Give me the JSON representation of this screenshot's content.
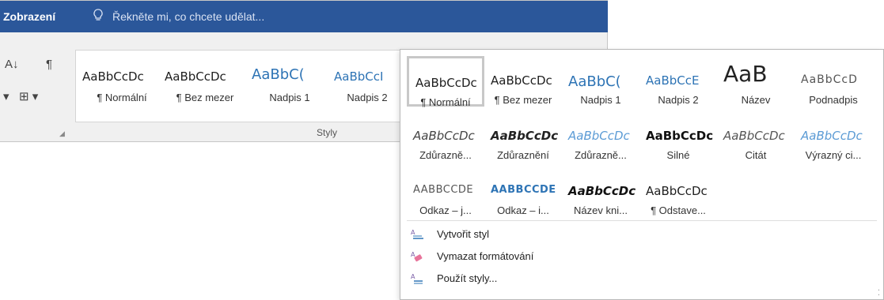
{
  "titlebar": {
    "tab_view": "Zobrazení",
    "tellme_placeholder": "Řekněte mi, co chcete udělat..."
  },
  "ribbon": {
    "gallery": [
      {
        "sample": "AaBbCcDc",
        "label": "¶ Normální",
        "style": "s-normal"
      },
      {
        "sample": "AaBbCcDc",
        "label": "¶ Bez mezer",
        "style": "s-normal"
      },
      {
        "sample": "AaBbC(",
        "label": "Nadpis 1",
        "style": "s-heading"
      },
      {
        "sample": "AaBbCcI",
        "label": "Nadpis 2",
        "style": "s-heading2"
      }
    ],
    "group_caption": "Styly"
  },
  "dropdown": {
    "styles": [
      {
        "sample": "AaBbCcDc",
        "label": "¶ Normální",
        "style": "s-normal",
        "selected": true
      },
      {
        "sample": "AaBbCcDc",
        "label": "¶ Bez mezer",
        "style": "s-normal"
      },
      {
        "sample": "AaBbC(",
        "label": "Nadpis 1",
        "style": "s-heading"
      },
      {
        "sample": "AaBbCcE",
        "label": "Nadpis 2",
        "style": "s-heading2"
      },
      {
        "sample": "AaB",
        "label": "Název",
        "style": "s-title"
      },
      {
        "sample": "AaBbCcD",
        "label": "Podnadpis",
        "style": "s-sub"
      },
      {
        "sample": "AaBbCcDc",
        "label": "Zdůrazně...",
        "style": "s-ital"
      },
      {
        "sample": "AaBbCcDc",
        "label": "Zdůraznění",
        "style": "s-italb"
      },
      {
        "sample": "AaBbCcDc",
        "label": "Zdůrazně...",
        "style": "s-italblue"
      },
      {
        "sample": "AaBbCcDc",
        "label": "Silné",
        "style": "s-bold"
      },
      {
        "sample": "AaBbCcDc",
        "label": "Citát",
        "style": "s-quote"
      },
      {
        "sample": "AaBbCcDc",
        "label": "Výrazný ci...",
        "style": "s-intense"
      },
      {
        "sample": "AABBCCDE",
        "label": "Odkaz – j...",
        "style": "s-caps"
      },
      {
        "sample": "AABBCCDE",
        "label": "Odkaz – i...",
        "style": "s-capsblue"
      },
      {
        "sample": "AaBbCcDc",
        "label": "Název kni...",
        "style": "s-booktitle"
      },
      {
        "sample": "AaBbCcDc",
        "label": "¶ Odstave...",
        "style": "s-normal"
      }
    ],
    "menu": {
      "create_style": "Vytvořit styl",
      "clear_formatting": "Vymazat formátování",
      "apply_styles": "Použít styly..."
    }
  }
}
